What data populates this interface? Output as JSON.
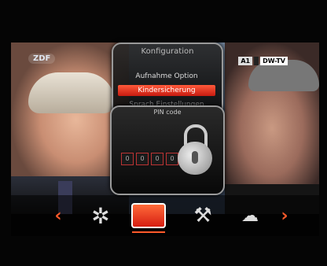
{
  "tv": {
    "channel_logo": "ZDF",
    "station_badge": [
      "A1",
      "",
      "DW-TV"
    ]
  },
  "config": {
    "title": "Konfiguration",
    "items": [
      {
        "label": "Aufnahme Option",
        "selected": false
      },
      {
        "label": "Kindersicherung",
        "selected": true
      },
      {
        "label": "Sprach Einstellungen",
        "selected": false
      }
    ]
  },
  "pin": {
    "title": "PIN code",
    "digits": [
      "0",
      "0",
      "0",
      "0"
    ]
  },
  "menubar": {
    "left_arrow": "‹",
    "right_arrow": "›",
    "icons": [
      "gear-icon",
      "tv-icon",
      "tools-icon",
      "devices-icon"
    ]
  },
  "colors": {
    "accent": "#ff5a2a",
    "selected": "#d61e12"
  }
}
